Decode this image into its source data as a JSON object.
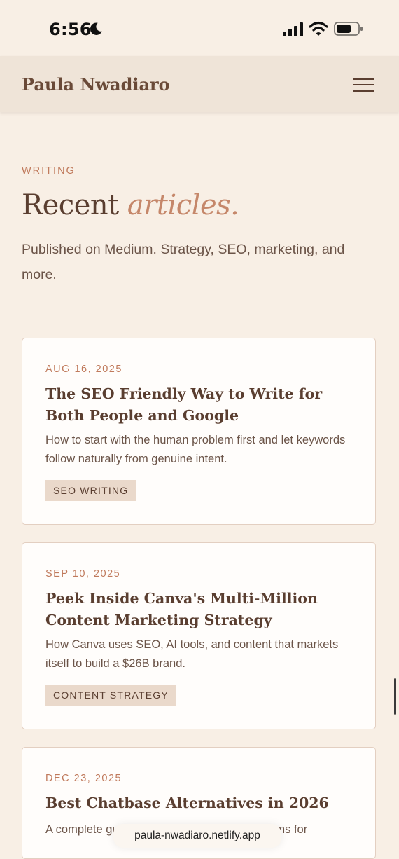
{
  "status_bar": {
    "time": "6:56"
  },
  "header": {
    "site_title": "Paula Nwadiaro"
  },
  "section": {
    "eyebrow": "WRITING",
    "title_main": "Recent",
    "title_accent": "articles.",
    "intro": "Published on Medium. Strategy, SEO, marketing, and more."
  },
  "articles": [
    {
      "date": "AUG 16, 2025",
      "title": "The SEO Friendly Way to Write for Both People and Google",
      "description": "How to start with the human problem first and let keywords follow naturally from genuine intent.",
      "tag": "SEO WRITING"
    },
    {
      "date": "SEP 10, 2025",
      "title": "Peek Inside Canva's Multi-Million Content Marketing Strategy",
      "description": "How Canva uses SEO, AI tools, and content that markets itself to build a $26B brand.",
      "tag": "CONTENT STRATEGY"
    },
    {
      "date": "DEC 23, 2025",
      "title": "Best Chatbase Alternatives in 2026",
      "description": "A complete guide to the top AI chatbot platforms for"
    }
  ],
  "browser": {
    "url": "paula-nwadiaro.netlify.app"
  },
  "colors": {
    "background": "#f8efe5",
    "accent": "#c07a5c",
    "text": "#5a3e30",
    "tag_bg": "#ead9cb"
  },
  "icons": [
    "moon-icon",
    "cellular-signal-icon",
    "wifi-icon",
    "battery-icon",
    "hamburger-menu-icon"
  ]
}
